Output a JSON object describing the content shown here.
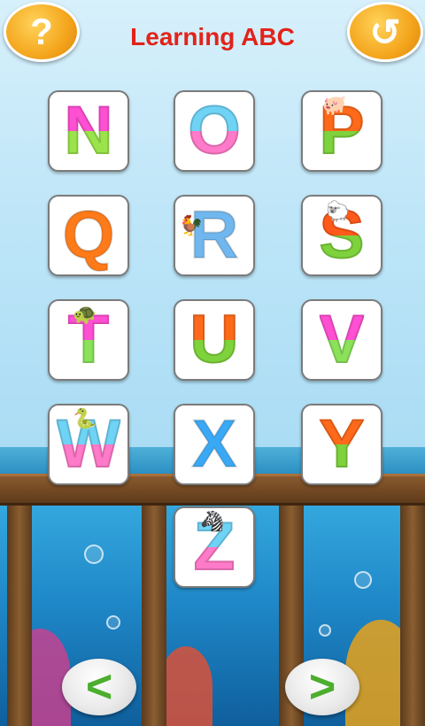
{
  "header": {
    "title": "Learning ABC",
    "help_icon": "?",
    "refresh_icon": "↺"
  },
  "tiles": [
    {
      "letter": "N",
      "colors": [
        "#ff4fd2",
        "#9be34a"
      ]
    },
    {
      "letter": "O",
      "colors": [
        "#6fd3f5",
        "#ff7ac8"
      ]
    },
    {
      "letter": "P",
      "colors": [
        "#ff6a1a",
        "#7ed23c"
      ],
      "animal": "pig-icon"
    },
    {
      "letter": "Q",
      "colors": [
        "#ff7a18",
        "#ff7a18"
      ]
    },
    {
      "letter": "R",
      "colors": [
        "#6fb7ee",
        "#6fb7ee"
      ],
      "animal": "rooster-icon"
    },
    {
      "letter": "S",
      "colors": [
        "#ff5a1a",
        "#7ed23c"
      ],
      "animal": "sheep-icon"
    },
    {
      "letter": "T",
      "colors": [
        "#ff4fd2",
        "#8be25a"
      ],
      "animal": "turtle-icon"
    },
    {
      "letter": "U",
      "colors": [
        "#ff6a1a",
        "#7ed23c"
      ]
    },
    {
      "letter": "V",
      "colors": [
        "#ff4fd2",
        "#8be25a"
      ]
    },
    {
      "letter": "W",
      "colors": [
        "#6fd3f5",
        "#ff7ac8"
      ],
      "animal": "snake-icon"
    },
    {
      "letter": "X",
      "colors": [
        "#3aa9f5",
        "#3aa9f5"
      ]
    },
    {
      "letter": "Y",
      "colors": [
        "#ff6a1a",
        "#7ed23c"
      ]
    },
    {
      "letter": "Z",
      "colors": [
        "#6fd3f5",
        "#ff7ac8"
      ],
      "animal": "zebra-icon"
    }
  ],
  "nav": {
    "prev_icon": "<",
    "next_icon": ">"
  }
}
